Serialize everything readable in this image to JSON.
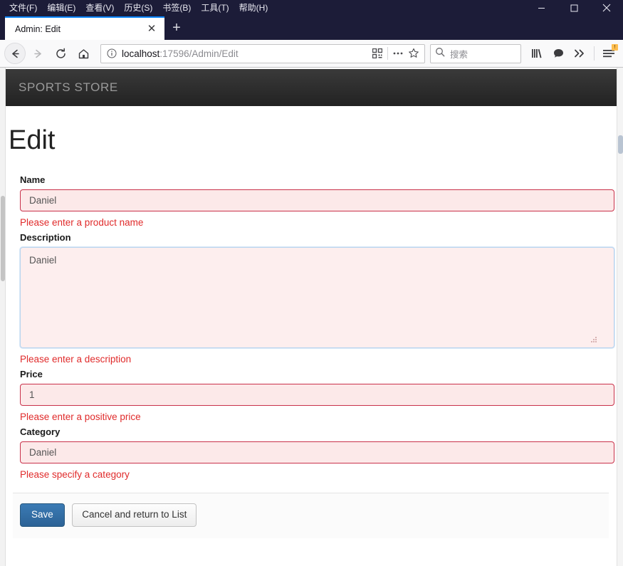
{
  "browser": {
    "menu_items": [
      {
        "label": "文件(F)",
        "accel": "F"
      },
      {
        "label": "编辑(E)",
        "accel": "E"
      },
      {
        "label": "查看(V)",
        "accel": "V"
      },
      {
        "label": "历史(S)",
        "accel": "S"
      },
      {
        "label": "书签(B)",
        "accel": "B"
      },
      {
        "label": "工具(T)",
        "accel": "T"
      },
      {
        "label": "帮助(H)",
        "accel": "H"
      }
    ],
    "window_controls": {
      "minimize": "–",
      "maximize": "□",
      "close": "✕"
    },
    "tab": {
      "title": "Admin: Edit",
      "close_label": "✕",
      "new_tab_label": "+"
    },
    "nav": {
      "back_label": "←",
      "forward_label": "→",
      "reload_label": "⟳",
      "home_label": "⌂"
    },
    "url": {
      "host": "localhost",
      "path": ":17596/Admin/Edit",
      "full": "localhost:17596/Admin/Edit",
      "identity_icon": "info-circle-icon",
      "reader_icon": "qr-reader-icon",
      "page_actions_icon": "ellipsis-icon",
      "bookmark_icon": "star-icon"
    },
    "search": {
      "placeholder": "搜索",
      "icon": "search-icon"
    },
    "toolbar_icons": [
      {
        "name": "library-icon",
        "glyph": "|||\\"
      },
      {
        "name": "pocket-icon",
        "glyph": "●"
      },
      {
        "name": "overflow-chevron-icon",
        "glyph": "»"
      },
      {
        "name": "hamburger-menu-icon",
        "glyph": "☰"
      }
    ],
    "hamburger_badge": "!"
  },
  "site": {
    "brand": "SPORTS STORE",
    "brand_color": "#9a9a9a",
    "navbar_color": "#2c2c2c"
  },
  "page": {
    "title": "Edit",
    "accent_error_color": "#e02b2b",
    "accent_primary_color": "#2c6296",
    "fields": [
      {
        "name": "name",
        "label": "Name",
        "value": "Daniel",
        "placeholder": "Daniel",
        "error": "Please enter a product name",
        "type": "text"
      },
      {
        "name": "description",
        "label": "Description",
        "value": "Daniel",
        "placeholder": "Daniel",
        "error": "Please enter a description",
        "type": "textarea"
      },
      {
        "name": "price",
        "label": "Price",
        "value": "1",
        "placeholder": "1",
        "error": "Please enter a positive price",
        "type": "text"
      },
      {
        "name": "category",
        "label": "Category",
        "value": "Daniel",
        "placeholder": "Daniel",
        "error": "Please specify a category",
        "type": "text"
      }
    ],
    "buttons": {
      "save": "Save",
      "cancel": "Cancel and return to List"
    }
  }
}
